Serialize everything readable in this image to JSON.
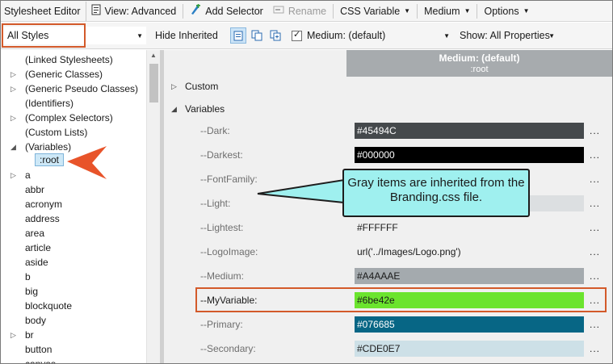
{
  "toolbar": {
    "title": "Stylesheet Editor",
    "view_label": "View: Advanced",
    "add_selector_label": "Add Selector",
    "rename_label": "Rename",
    "css_variable_label": "CSS Variable",
    "medium_label": "Medium",
    "options_label": "Options"
  },
  "filterbar": {
    "styles_value": "All Styles",
    "hide_inherited_label": "Hide Inherited",
    "medium_value": "Medium: (default)",
    "show_properties_value": "Show: All Properties"
  },
  "tree": {
    "items": [
      {
        "label": "(Linked Stylesheets)",
        "expander": ""
      },
      {
        "label": "(Generic Classes)",
        "expander": "▷"
      },
      {
        "label": "(Generic Pseudo Classes)",
        "expander": "▷"
      },
      {
        "label": "(Identifiers)",
        "expander": ""
      },
      {
        "label": "(Complex Selectors)",
        "expander": "▷"
      },
      {
        "label": "(Custom Lists)",
        "expander": ""
      },
      {
        "label": "(Variables)",
        "expander": "◢"
      },
      {
        "label": "a",
        "expander": "▷"
      },
      {
        "label": "abbr",
        "expander": ""
      },
      {
        "label": "acronym",
        "expander": ""
      },
      {
        "label": "address",
        "expander": ""
      },
      {
        "label": "area",
        "expander": ""
      },
      {
        "label": "article",
        "expander": ""
      },
      {
        "label": "aside",
        "expander": ""
      },
      {
        "label": "b",
        "expander": ""
      },
      {
        "label": "big",
        "expander": ""
      },
      {
        "label": "blockquote",
        "expander": ""
      },
      {
        "label": "body",
        "expander": ""
      },
      {
        "label": "br",
        "expander": "▷"
      },
      {
        "label": "button",
        "expander": ""
      },
      {
        "label": "canvas",
        "expander": ""
      }
    ],
    "selected_child": ":root"
  },
  "header": {
    "medium": "Medium: (default)",
    "selector": ":root"
  },
  "groups": {
    "custom": "Custom",
    "variables": "Variables"
  },
  "properties": [
    {
      "name": "--Dark:",
      "value": "#45494C",
      "swatch": "#45494C",
      "text_color": "#ffffff",
      "inherited": true
    },
    {
      "name": "--Darkest:",
      "value": "#000000",
      "swatch": "#000000",
      "text_color": "#ffffff",
      "inherited": true
    },
    {
      "name": "--FontFamily:",
      "value": "",
      "swatch": "",
      "text_color": "#1a1a1a",
      "inherited": true
    },
    {
      "name": "--Light:",
      "value": "",
      "swatch": "#DCDFE1",
      "text_color": "#1a1a1a",
      "inherited": true
    },
    {
      "name": "--Lightest:",
      "value": "#FFFFFF",
      "swatch": "",
      "text_color": "#1a1a1a",
      "inherited": true
    },
    {
      "name": "--LogoImage:",
      "value": "url('../Images/Logo.png')",
      "swatch": "",
      "text_color": "#1a1a1a",
      "inherited": true
    },
    {
      "name": "--Medium:",
      "value": "#A4AAAE",
      "swatch": "#A4AAAE",
      "text_color": "#1a1a1a",
      "inherited": true
    },
    {
      "name": "--MyVariable:",
      "value": "#6be42e",
      "swatch": "#6be42e",
      "text_color": "#1a1a1a",
      "inherited": false
    },
    {
      "name": "--Primary:",
      "value": "#076685",
      "swatch": "#076685",
      "text_color": "#ffffff",
      "inherited": true
    },
    {
      "name": "--Secondary:",
      "value": "#CDE0E7",
      "swatch": "#CDE0E7",
      "text_color": "#1a1a1a",
      "inherited": true
    }
  ],
  "ellipsis": "...",
  "callout": {
    "text": "Gray items are inherited from the Branding.css file."
  },
  "colors": {
    "highlight_border": "#d35a2a",
    "callout_fill": "#9ff0ef",
    "arrow_fill": "#e8542a",
    "header_fill": "#a7abae"
  }
}
